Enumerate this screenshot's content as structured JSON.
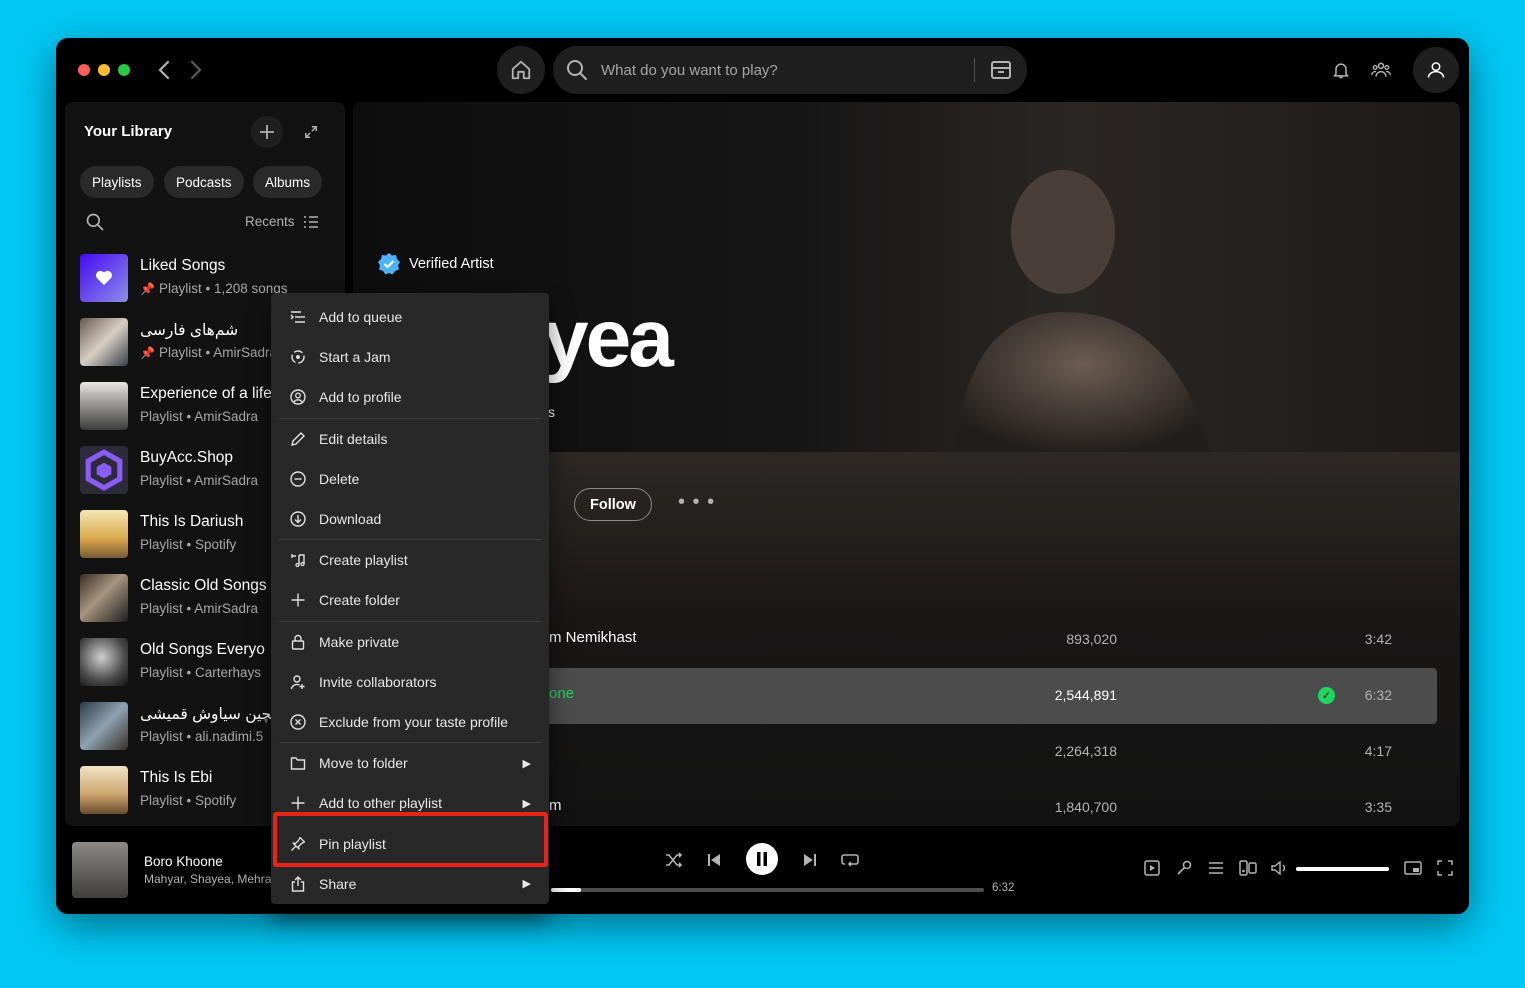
{
  "topbar": {
    "search_placeholder": "What do you want to play?"
  },
  "library": {
    "title": "Your Library",
    "filters": [
      "Playlists",
      "Podcasts",
      "Albums"
    ],
    "sort_label": "Recents",
    "items": [
      {
        "name": "Liked Songs",
        "sub": "Playlist • 1,208 songs",
        "pinned": true
      },
      {
        "name": "شم‌های فارسی",
        "sub": "Playlist • AmirSadra",
        "pinned": true
      },
      {
        "name": "Experience of a life",
        "sub": "Playlist • AmirSadra",
        "pinned": false
      },
      {
        "name": "BuyAcc.Shop",
        "sub": "Playlist • AmirSadra",
        "pinned": false
      },
      {
        "name": "This Is Dariush",
        "sub": "Playlist • Spotify",
        "pinned": false
      },
      {
        "name": "Classic Old Songs",
        "sub": "Playlist • AmirSadra",
        "pinned": false
      },
      {
        "name": "Old Songs Everyo",
        "sub": "Playlist • Carterhays",
        "pinned": false
      },
      {
        "name": "لچین سیاوش قمیشی",
        "sub": "Playlist • ali.nadimi.5",
        "pinned": false
      },
      {
        "name": "This Is Ebi",
        "sub": "Playlist • Spotify",
        "pinned": false
      }
    ]
  },
  "artist": {
    "verified_label": "Verified Artist",
    "name_fragment": "yea",
    "listeners_fragment": "s",
    "follow_label": "Follow",
    "more_label": "• • •"
  },
  "tracks": [
    {
      "title": "m Nemikhast",
      "plays": "893,020",
      "duration": "3:42",
      "active": false
    },
    {
      "title": "one",
      "plays": "2,544,891",
      "duration": "6:32",
      "active": true
    },
    {
      "title": "",
      "plays": "2,264,318",
      "duration": "4:17",
      "active": false
    },
    {
      "title": "m",
      "plays": "1,840,700",
      "duration": "3:35",
      "active": false
    }
  ],
  "now_playing": {
    "title": "Boro Khoone",
    "artists": "Mahyar, Shayea, Mehrad",
    "total_time": "6:32",
    "progress": 0.07,
    "volume": 1.0
  },
  "context_menu": {
    "items": [
      {
        "label": "Add to queue",
        "icon": "queue-icon"
      },
      {
        "label": "Start a Jam",
        "icon": "jam-icon"
      },
      {
        "label": "Add to profile",
        "icon": "profile-icon"
      },
      {
        "label": "Edit details",
        "icon": "pencil-icon"
      },
      {
        "label": "Delete",
        "icon": "minus-circle-icon"
      },
      {
        "label": "Download",
        "icon": "download-icon"
      },
      {
        "label": "Create playlist",
        "icon": "music-note-icon"
      },
      {
        "label": "Create folder",
        "icon": "plus-icon"
      },
      {
        "label": "Make private",
        "icon": "lock-icon"
      },
      {
        "label": "Invite collaborators",
        "icon": "person-add-icon"
      },
      {
        "label": "Exclude from your taste profile",
        "icon": "exclude-icon"
      },
      {
        "label": "Move to folder",
        "icon": "folder-icon"
      },
      {
        "label": "Add to other playlist",
        "icon": "plus-icon"
      },
      {
        "label": "Pin playlist",
        "icon": "pin-icon"
      },
      {
        "label": "Share",
        "icon": "share-icon"
      }
    ]
  },
  "colors": {
    "accent": "#1ed760",
    "highlight": "#e8231a",
    "background": "#00c8f5"
  }
}
